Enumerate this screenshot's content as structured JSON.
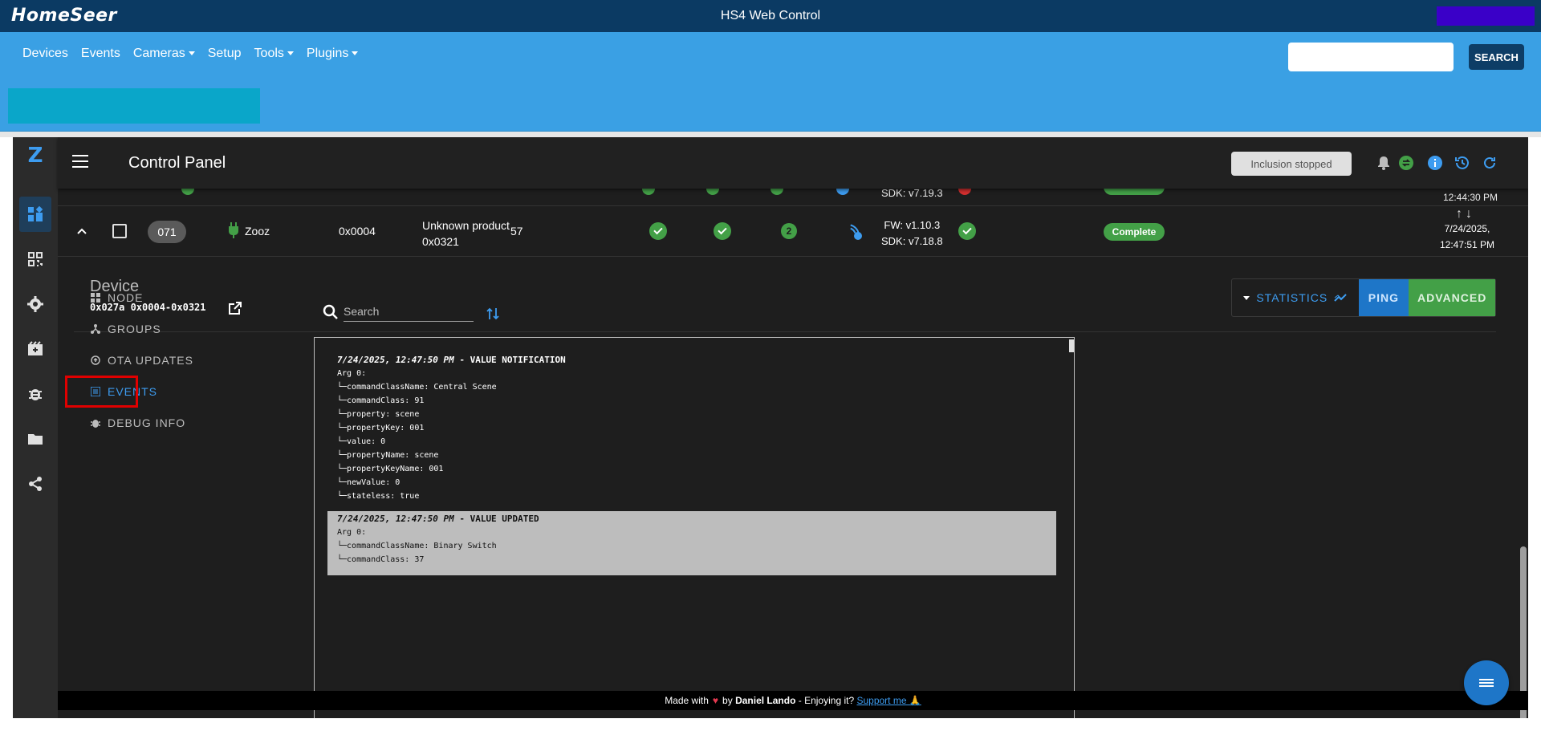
{
  "homeseer": {
    "logo": "HomeSeer",
    "title": "HS4 Web Control",
    "nav": [
      "Devices",
      "Events",
      "Cameras",
      "Setup",
      "Tools",
      "Plugins"
    ],
    "search_button": "SEARCH"
  },
  "header": {
    "title": "Control Panel",
    "inclusion_status": "Inclusion stopped"
  },
  "partial_row": {
    "sdk": "SDK: v7.19.3",
    "time": "12:44:30 PM"
  },
  "node_row": {
    "id": "071",
    "manufacturer": "Zooz",
    "product_id": "0x0004",
    "product_line1": "Unknown product",
    "product_line2": "0x0321",
    "number": "57",
    "security_level": "2",
    "fw": "FW: v1.10.3",
    "sdk": "SDK: v7.18.8",
    "interview": "Complete",
    "date": "7/24/2025,",
    "time": "12:47:51 PM"
  },
  "device": {
    "label": "Device",
    "ids": "0x027a 0x0004-0x0321",
    "btn_statistics": "STATISTICS",
    "btn_ping": "PING",
    "btn_advanced": "ADVANCED"
  },
  "tabs": {
    "node": "NODE",
    "groups": "GROUPS",
    "ota": "OTA UPDATES",
    "events": "EVENTS",
    "debug": "DEBUG INFO"
  },
  "search": {
    "placeholder": "Search"
  },
  "events": [
    {
      "timestamp": "7/24/2025, 12:47:50 PM",
      "type": " - VALUE NOTIFICATION",
      "arg": "Arg 0:",
      "lines": [
        "└─commandClassName: Central Scene",
        "└─commandClass: 91",
        "└─property: scene",
        "└─propertyKey: 001",
        "└─value: 0",
        "└─propertyName: scene",
        "└─propertyKeyName: 001",
        "└─newValue: 0",
        "└─stateless: true"
      ]
    },
    {
      "timestamp": "7/24/2025, 12:47:50 PM",
      "type": " - VALUE UPDATED",
      "arg": "Arg 0:",
      "lines": [
        "└─commandClassName: Binary Switch",
        "└─commandClass: 37"
      ]
    }
  ],
  "footer": {
    "made_with": "Made with",
    "by": "by",
    "author": "Daniel Lando",
    "enjoying": " - Enjoying it?",
    "support": "Support me 🙏"
  },
  "colors": {
    "accent": "#3d9cf0",
    "success": "#43a047",
    "hs_nav": "#3aa0e4",
    "hs_top": "#0b3a63"
  }
}
